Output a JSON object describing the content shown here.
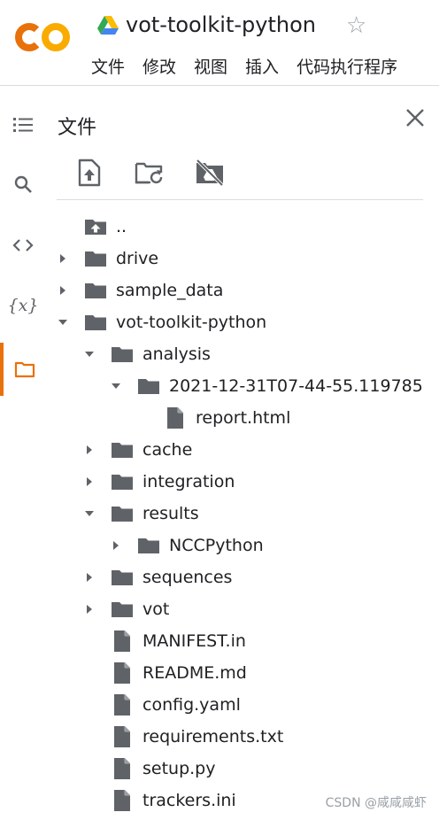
{
  "header": {
    "notebook_title": "vot-toolkit-python",
    "logo_text": "CO",
    "menu": [
      "文件",
      "修改",
      "视图",
      "插入",
      "代码执行程序"
    ]
  },
  "sidebar_rail": [
    {
      "icon": "table-of-contents-icon"
    },
    {
      "icon": "search-icon"
    },
    {
      "icon": "code-snippets-icon"
    },
    {
      "icon": "variables-icon",
      "glyph": "{x}"
    },
    {
      "icon": "folder-icon",
      "active": true
    }
  ],
  "files_panel": {
    "title": "文件",
    "toolbar": [
      "upload-file-icon",
      "refresh-folder-icon",
      "unmount-drive-icon"
    ],
    "tree": [
      {
        "name": "..",
        "type": "parent",
        "depth": 0,
        "expand": "none"
      },
      {
        "name": "drive",
        "type": "folder",
        "depth": 0,
        "expand": "collapsed"
      },
      {
        "name": "sample_data",
        "type": "folder",
        "depth": 0,
        "expand": "collapsed"
      },
      {
        "name": "vot-toolkit-python",
        "type": "folder",
        "depth": 0,
        "expand": "expanded"
      },
      {
        "name": "analysis",
        "type": "folder",
        "depth": 1,
        "expand": "expanded"
      },
      {
        "name": "2021-12-31T07-44-55.119785",
        "type": "folder",
        "depth": 2,
        "expand": "expanded"
      },
      {
        "name": "report.html",
        "type": "file",
        "depth": 3,
        "expand": "none"
      },
      {
        "name": "cache",
        "type": "folder",
        "depth": 1,
        "expand": "collapsed"
      },
      {
        "name": "integration",
        "type": "folder",
        "depth": 1,
        "expand": "collapsed"
      },
      {
        "name": "results",
        "type": "folder",
        "depth": 1,
        "expand": "expanded"
      },
      {
        "name": "NCCPython",
        "type": "folder",
        "depth": 2,
        "expand": "collapsed"
      },
      {
        "name": "sequences",
        "type": "folder",
        "depth": 1,
        "expand": "collapsed"
      },
      {
        "name": "vot",
        "type": "folder",
        "depth": 1,
        "expand": "collapsed"
      },
      {
        "name": "MANIFEST.in",
        "type": "file",
        "depth": 1,
        "expand": "none"
      },
      {
        "name": "README.md",
        "type": "file",
        "depth": 1,
        "expand": "none"
      },
      {
        "name": "config.yaml",
        "type": "file",
        "depth": 1,
        "expand": "none"
      },
      {
        "name": "requirements.txt",
        "type": "file",
        "depth": 1,
        "expand": "none"
      },
      {
        "name": "setup.py",
        "type": "file",
        "depth": 1,
        "expand": "none"
      },
      {
        "name": "trackers.ini",
        "type": "file",
        "depth": 1,
        "expand": "none"
      }
    ]
  },
  "watermark": "CSDN @咸咸咸虾",
  "colors": {
    "accent": "#e8710a",
    "logo_orange": "#f9ab00",
    "logo_dark_orange": "#e8710a",
    "icon_gray": "#5f6368"
  }
}
